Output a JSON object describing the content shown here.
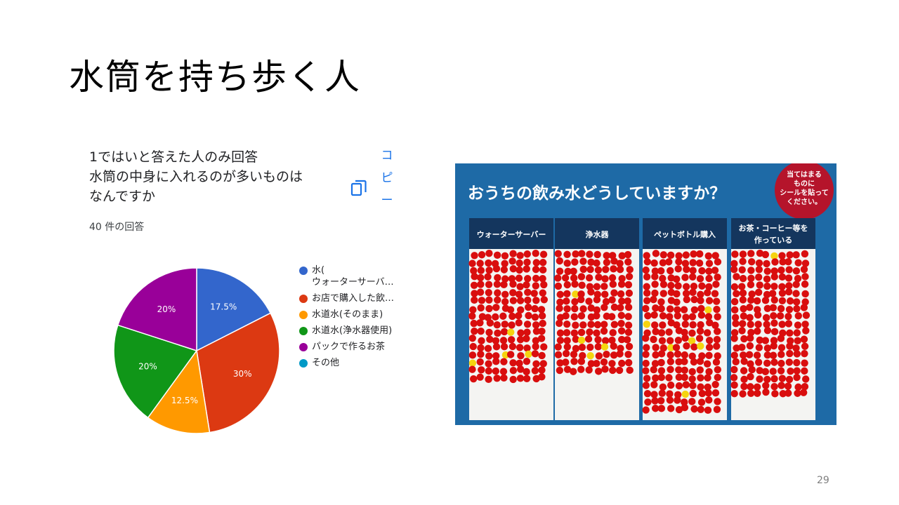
{
  "slide": {
    "title": "水筒を持ち歩く人",
    "page_number": "29"
  },
  "form": {
    "question_lines": [
      "1ではいと答えた人のみ回答",
      "水筒の中身に入れるのが多いものは",
      "なんですか"
    ],
    "response_count": "40 件の回答",
    "copy_label": [
      "コ",
      "ピ",
      "ー"
    ]
  },
  "chart_data": {
    "type": "pie",
    "slices": [
      {
        "label": "水(",
        "label_line2": "ウォーターサーバ…",
        "value": 17.5,
        "display": "17.5%",
        "color": "#3366cc"
      },
      {
        "label": "お店で購入した飲…",
        "value": 30,
        "display": "30%",
        "color": "#dc3912"
      },
      {
        "label": "水道水(そのまま)",
        "value": 12.5,
        "display": "12.5%",
        "color": "#ff9900"
      },
      {
        "label": "水道水(浄水器使用)",
        "value": 20,
        "display": "20%",
        "color": "#109618"
      },
      {
        "label": "パックで作るお茶",
        "value": 20,
        "display": "20%",
        "color": "#990099"
      },
      {
        "label": "その他",
        "value": 0,
        "display": "",
        "color": "#0099c6"
      }
    ],
    "start_angle_deg": 90,
    "direction": "clockwise",
    "legend_position": "right"
  },
  "photo": {
    "board_title": "おうちの飲み水どうしていますか？",
    "sticker_lines": [
      "当てはまる",
      "ものに",
      "シールを貼って",
      "ください。"
    ],
    "columns": [
      {
        "lines": [
          "ウォーターサーバー"
        ]
      },
      {
        "lines": [
          "浄水器"
        ]
      },
      {
        "lines": [
          "ペットボトル購入"
        ]
      },
      {
        "lines": [
          "お茶・コーヒー等を",
          "作っている"
        ]
      }
    ],
    "colors": {
      "board": "#1e6aa6",
      "header": "#14365e",
      "dot": "#d90e0e",
      "accent_dot": "#f5d40f",
      "sticker": "#b5142b"
    }
  }
}
